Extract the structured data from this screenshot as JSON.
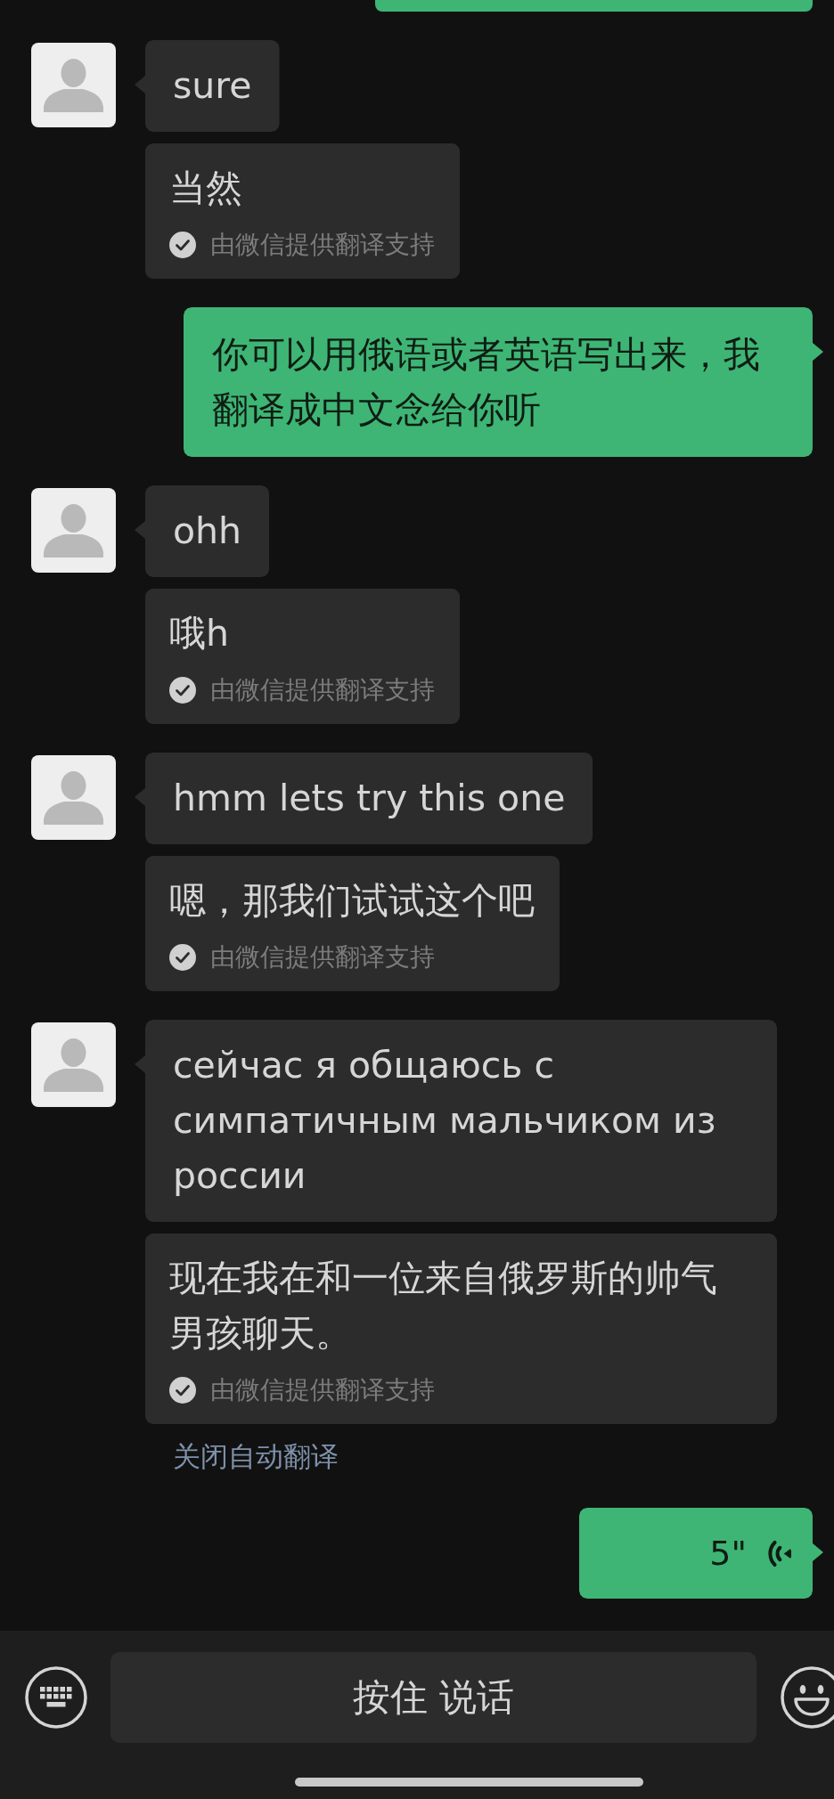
{
  "messages": [
    {
      "kind": "clipped",
      "outgoing": true
    },
    {
      "kind": "text",
      "outgoing": false,
      "text": "sure",
      "translation": {
        "text": "当然",
        "note": "由微信提供翻译支持"
      }
    },
    {
      "kind": "text",
      "outgoing": true,
      "text": "你可以用俄语或者英语写出来，我翻译成中文念给你听"
    },
    {
      "kind": "text",
      "outgoing": false,
      "text": "ohh",
      "translation": {
        "text": "哦h",
        "note": "由微信提供翻译支持"
      }
    },
    {
      "kind": "text",
      "outgoing": false,
      "text": "hmm lets try this one",
      "translation": {
        "text": "嗯，那我们试试这个吧",
        "note": "由微信提供翻译支持"
      }
    },
    {
      "kind": "text",
      "outgoing": false,
      "text": "сейчас я общаюсь с симпатичным мальчиком из россии",
      "translation": {
        "text": "现在我在和一位来自俄罗斯的帅气男孩聊天。",
        "note": "由微信提供翻译支持"
      }
    },
    {
      "kind": "action_link",
      "text": "关闭自动翻译"
    },
    {
      "kind": "voice",
      "outgoing": true,
      "duration": "5\""
    }
  ],
  "input_bar": {
    "hold_to_talk": "按住 说话"
  }
}
